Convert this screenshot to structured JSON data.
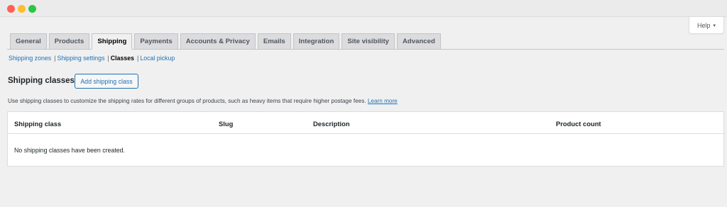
{
  "window": {
    "controls": [
      "close",
      "minimize",
      "zoom"
    ]
  },
  "help": {
    "label": "Help",
    "caret": "▾"
  },
  "tabs": [
    {
      "label": "General",
      "active": false
    },
    {
      "label": "Products",
      "active": false
    },
    {
      "label": "Shipping",
      "active": true
    },
    {
      "label": "Payments",
      "active": false
    },
    {
      "label": "Accounts & Privacy",
      "active": false
    },
    {
      "label": "Emails",
      "active": false
    },
    {
      "label": "Integration",
      "active": false
    },
    {
      "label": "Site visibility",
      "active": false
    },
    {
      "label": "Advanced",
      "active": false
    }
  ],
  "subnav": {
    "zones": "Shipping zones",
    "settings": "Shipping settings",
    "classes": "Classes",
    "pickup": "Local pickup",
    "separator": "|"
  },
  "section": {
    "title": "Shipping classes",
    "add_button": "Add shipping class",
    "description": "Use shipping classes to customize the shipping rates for different groups of products, such as heavy items that require higher postage fees.",
    "learn_more": "Learn more"
  },
  "table": {
    "columns": {
      "shipping_class": "Shipping class",
      "slug": "Slug",
      "description": "Description",
      "product_count": "Product count"
    },
    "empty_message": "No shipping classes have been created."
  },
  "colors": {
    "link": "#2271b1",
    "background": "#f0f0f1",
    "tab_inactive": "#dcdcde"
  }
}
